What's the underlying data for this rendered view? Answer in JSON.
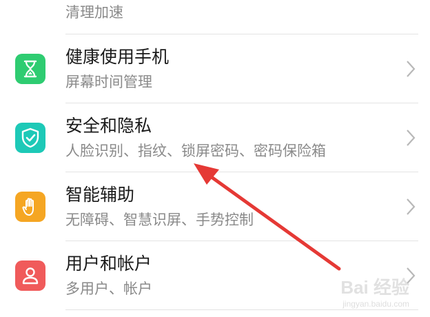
{
  "settings_list": {
    "items": [
      {
        "id": "cleanup",
        "title": "",
        "subtitle": "清理加速",
        "icon": "storage-icon",
        "color": "#8e8e93"
      },
      {
        "id": "digital-balance",
        "title": "健康使用手机",
        "subtitle": "屏幕时间管理",
        "icon": "hourglass-icon",
        "color": "#2ecc71"
      },
      {
        "id": "security",
        "title": "安全和隐私",
        "subtitle": "人脸识别、指纹、锁屏密码、密码保险箱",
        "icon": "shield-check-icon",
        "color": "#1dc9b7"
      },
      {
        "id": "accessibility",
        "title": "智能辅助",
        "subtitle": "无障碍、智慧识屏、手势控制",
        "icon": "hand-icon",
        "color": "#f5a623"
      },
      {
        "id": "users",
        "title": "用户和帐户",
        "subtitle": "多用户、帐户",
        "icon": "person-icon",
        "color": "#f05b5b"
      }
    ]
  },
  "annotation": {
    "arrow_color": "#e53935"
  },
  "watermark": {
    "logo": "Bai 经验",
    "url": "jingyan.baidu.com"
  }
}
